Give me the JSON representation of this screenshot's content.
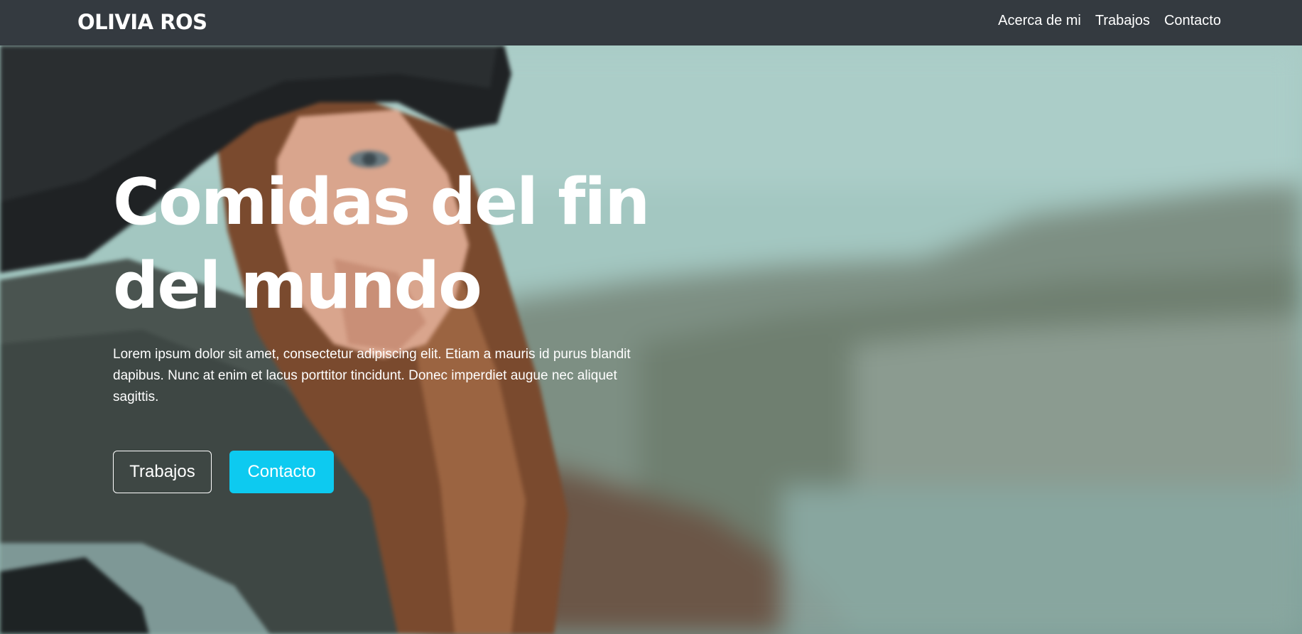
{
  "navbar": {
    "brand": "OLIVIA ROS",
    "links": [
      {
        "label": "Acerca de mi"
      },
      {
        "label": "Trabajos"
      },
      {
        "label": "Contacto"
      }
    ]
  },
  "hero": {
    "title": "Comidas del fin del mundo",
    "text": "Lorem ipsum dolor sit amet, consectetur adipiscing elit. Etiam a mauris id purus blandit dapibus. Nunc at enim et lacus porttitor tincidunt. Donec imperdiet augue nec aliquet sagittis.",
    "buttons": {
      "works_label": "Trabajos",
      "contact_label": "Contacto"
    }
  },
  "colors": {
    "navbar_bg": "#343a40",
    "accent": "#0dcaf0",
    "text": "#ffffff"
  }
}
